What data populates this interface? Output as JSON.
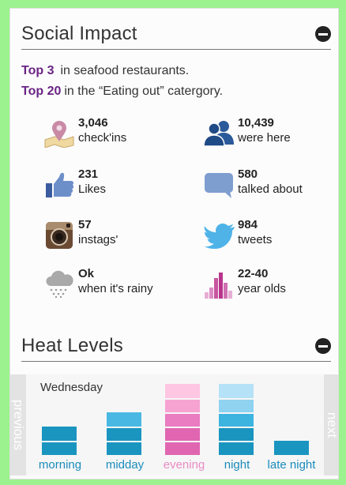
{
  "social": {
    "title": "Social Impact",
    "rank1_hl": "Top 3",
    "rank1_text": "in seafood restaurants.",
    "rank2_hl": "Top 20",
    "rank2_text": "in the “Eating out” catergory.",
    "stats": [
      {
        "num": "3,046",
        "label": "check'ins",
        "icon": "map-pin-icon"
      },
      {
        "num": "10,439",
        "label": "were here",
        "icon": "people-icon"
      },
      {
        "num": "231",
        "label": "Likes",
        "icon": "thumbs-up-icon"
      },
      {
        "num": "580",
        "label": "talked about",
        "icon": "speech-bubble-icon"
      },
      {
        "num": "57",
        "label": "instags'",
        "icon": "instagram-icon"
      },
      {
        "num": "984",
        "label": "tweets",
        "icon": "twitter-bird-icon"
      },
      {
        "num": "Ok",
        "label": "when it's rainy",
        "icon": "rain-cloud-icon"
      },
      {
        "num": "22-40",
        "label": "year olds",
        "icon": "age-bars-icon"
      }
    ]
  },
  "heat": {
    "title": "Heat Levels",
    "day": "Wednesday",
    "prev_label": "previous",
    "next_label": "next",
    "colors": {
      "blue": "#1a95c0",
      "pink": "#e066b1"
    },
    "slots": [
      {
        "label": "morning",
        "level": 2,
        "max": 5,
        "color": "blue"
      },
      {
        "label": "midday",
        "level": 3,
        "max": 5,
        "color": "blue"
      },
      {
        "label": "evening",
        "level": 5,
        "max": 5,
        "color": "pink"
      },
      {
        "label": "night",
        "level": 5,
        "max": 5,
        "color": "blue"
      },
      {
        "label": "late night",
        "level": 1,
        "max": 5,
        "color": "blue"
      }
    ]
  }
}
